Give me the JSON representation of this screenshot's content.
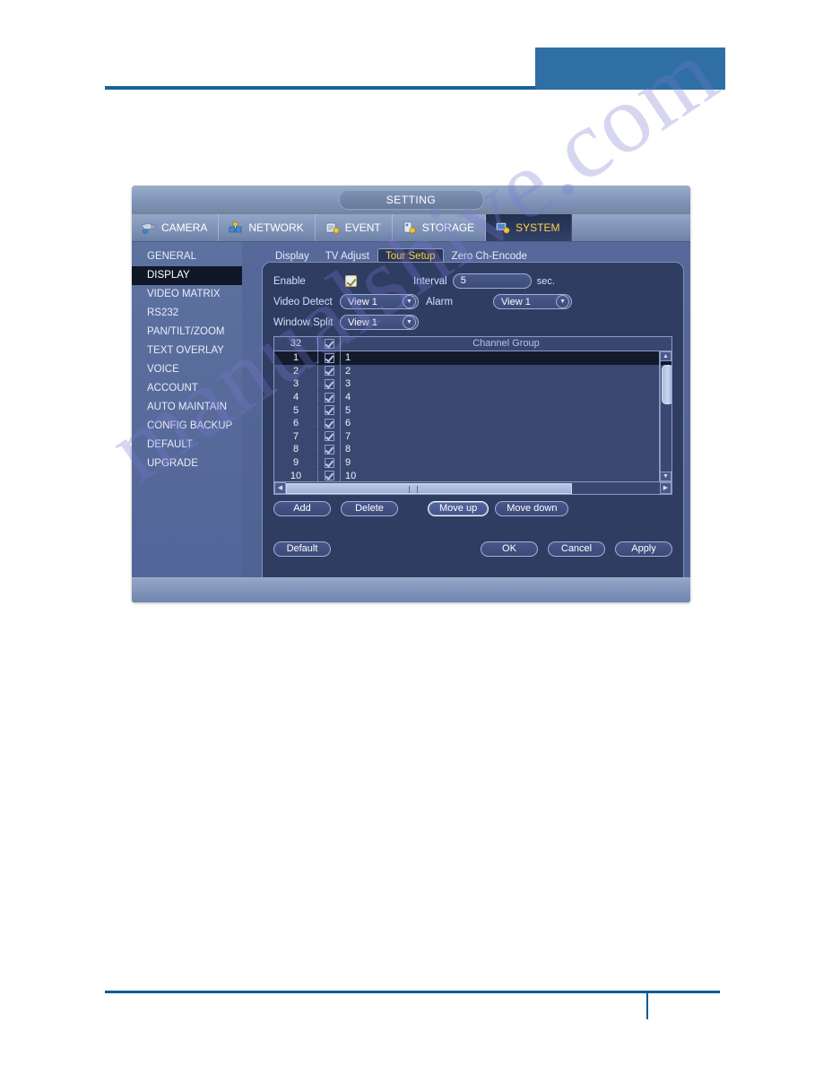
{
  "page": {
    "header_block_color": "#2f6fa3",
    "rule_color": "#15639c",
    "watermark_text": "manualshive.com"
  },
  "window": {
    "title": "SETTING",
    "main_tabs": [
      {
        "label": "CAMERA",
        "icon": "camera-icon",
        "active": false
      },
      {
        "label": "NETWORK",
        "icon": "network-icon",
        "active": false
      },
      {
        "label": "EVENT",
        "icon": "event-icon",
        "active": false
      },
      {
        "label": "STORAGE",
        "icon": "storage-icon",
        "active": false
      },
      {
        "label": "SYSTEM",
        "icon": "system-icon",
        "active": true
      }
    ],
    "sidebar": {
      "items": [
        {
          "label": "GENERAL",
          "active": false
        },
        {
          "label": "DISPLAY",
          "active": true
        },
        {
          "label": "VIDEO MATRIX",
          "active": false
        },
        {
          "label": "RS232",
          "active": false
        },
        {
          "label": "PAN/TILT/ZOOM",
          "active": false
        },
        {
          "label": "TEXT OVERLAY",
          "active": false
        },
        {
          "label": "VOICE",
          "active": false
        },
        {
          "label": "ACCOUNT",
          "active": false
        },
        {
          "label": "AUTO MAINTAIN",
          "active": false
        },
        {
          "label": "CONFIG BACKUP",
          "active": false
        },
        {
          "label": "DEFAULT",
          "active": false
        },
        {
          "label": "UPGRADE",
          "active": false
        }
      ]
    },
    "sub_tabs": [
      {
        "label": "Display",
        "active": false
      },
      {
        "label": "TV Adjust",
        "active": false
      },
      {
        "label": "Tour Setup",
        "active": true
      },
      {
        "label": "Zero Ch-Encode",
        "active": false
      }
    ],
    "form": {
      "enable_label": "Enable",
      "enable_checked": true,
      "interval_label": "Interval",
      "interval_value": "5",
      "interval_unit": "sec.",
      "video_detect_label": "Video Detect",
      "video_detect_value": "View 1",
      "alarm_label": "Alarm",
      "alarm_value": "View 1",
      "window_split_label": "Window Split",
      "window_split_value": "View 1"
    },
    "list": {
      "header_count": "32",
      "header_checked": true,
      "header_title": "Channel Group",
      "rows": [
        {
          "num": "1",
          "checked": true,
          "value": "1",
          "selected": true
        },
        {
          "num": "2",
          "checked": true,
          "value": "2",
          "selected": false
        },
        {
          "num": "3",
          "checked": true,
          "value": "3",
          "selected": false
        },
        {
          "num": "4",
          "checked": true,
          "value": "4",
          "selected": false
        },
        {
          "num": "5",
          "checked": true,
          "value": "5",
          "selected": false
        },
        {
          "num": "6",
          "checked": true,
          "value": "6",
          "selected": false
        },
        {
          "num": "7",
          "checked": true,
          "value": "7",
          "selected": false
        },
        {
          "num": "8",
          "checked": true,
          "value": "8",
          "selected": false
        },
        {
          "num": "9",
          "checked": true,
          "value": "9",
          "selected": false
        },
        {
          "num": "10",
          "checked": true,
          "value": "10",
          "selected": false
        }
      ]
    },
    "list_buttons": [
      {
        "label": "Add",
        "focus": false
      },
      {
        "label": "Delete",
        "focus": false
      },
      {
        "label": "Move up",
        "focus": true
      },
      {
        "label": "Move down",
        "focus": false
      }
    ],
    "action_buttons": {
      "default": "Default",
      "ok": "OK",
      "cancel": "Cancel",
      "apply": "Apply"
    }
  }
}
